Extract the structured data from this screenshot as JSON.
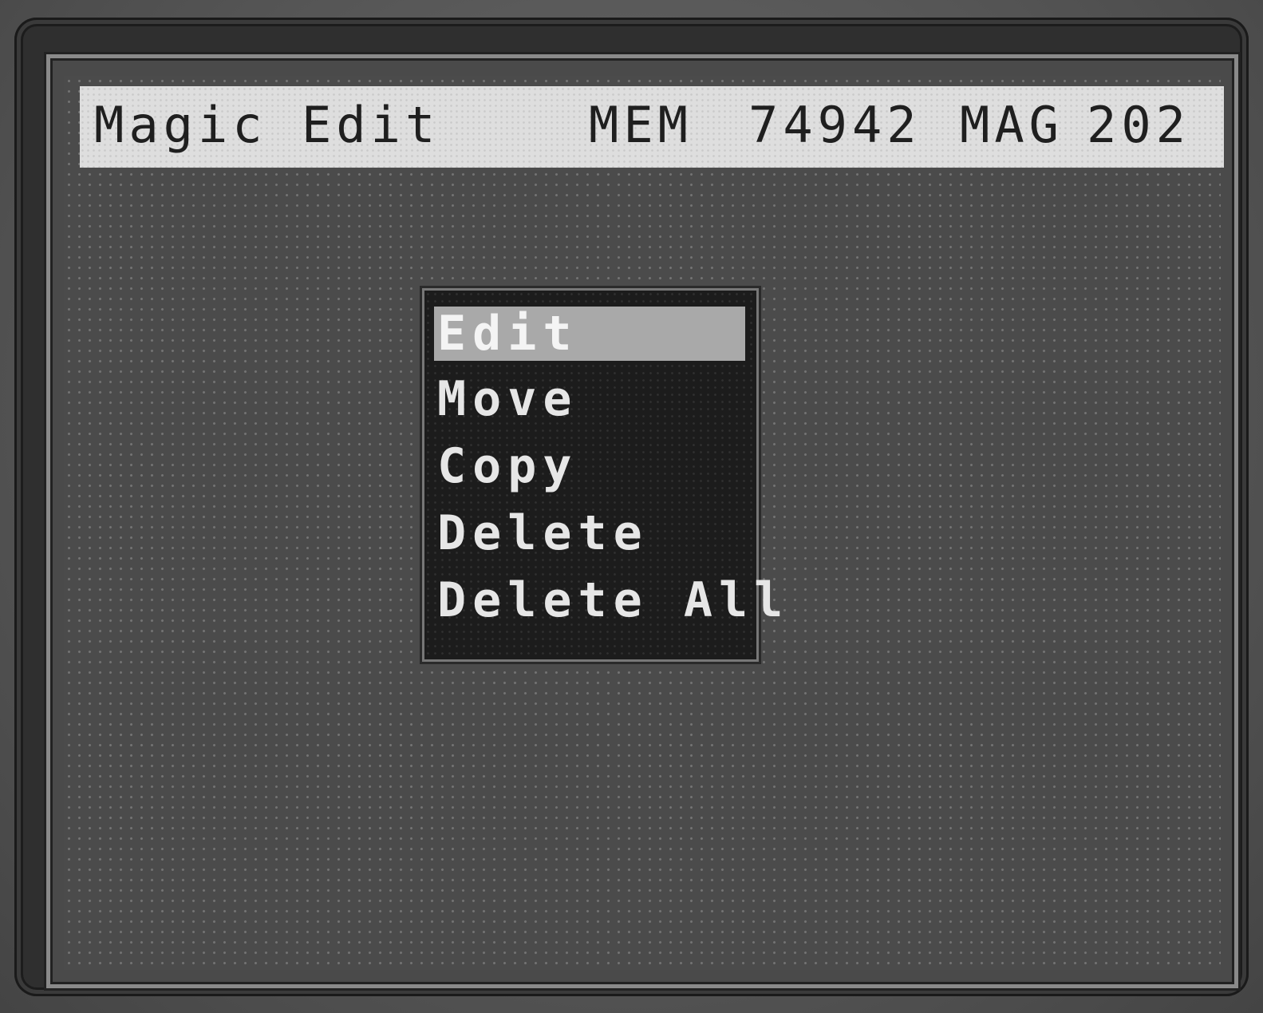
{
  "title_bar": {
    "app_name": "Magic Edit",
    "mem_label": "MEM",
    "mem_value": "74942",
    "mag_label": "MAG",
    "mag_value": "202"
  },
  "menu": {
    "selected_index": 0,
    "items": [
      {
        "label": "Edit"
      },
      {
        "label": "Move"
      },
      {
        "label": "Copy"
      },
      {
        "label": "Delete"
      },
      {
        "label": "Delete All"
      }
    ]
  }
}
